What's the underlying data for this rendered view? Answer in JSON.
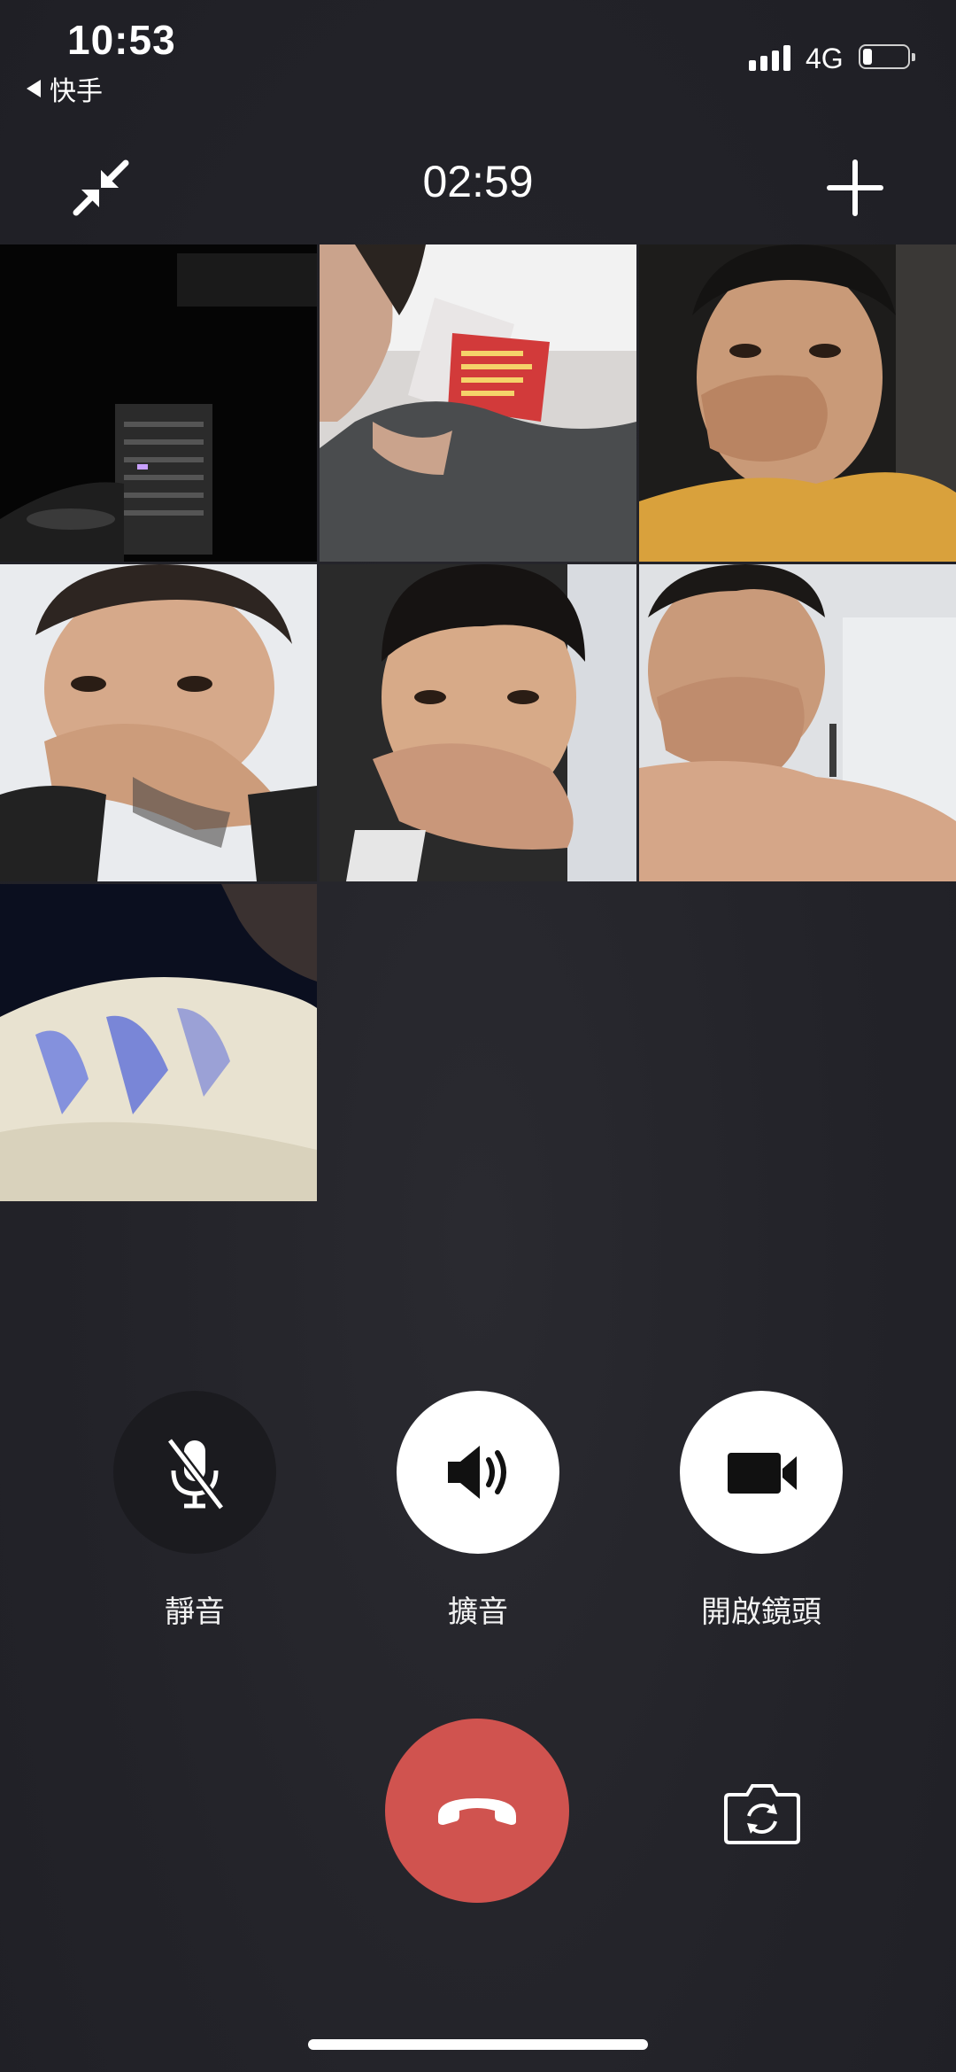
{
  "status_bar": {
    "time": "10:53",
    "back_app": "快手",
    "network": "4G",
    "battery_fraction": 0.2
  },
  "call": {
    "timer": "02:59",
    "participant_count": 7,
    "minimize_icon": "minimize-arrows-icon",
    "add_icon": "plus-icon"
  },
  "controls": {
    "mute": {
      "label": "靜音",
      "icon": "mic-off-icon",
      "active": true
    },
    "speaker": {
      "label": "擴音",
      "icon": "speaker-icon",
      "active": false
    },
    "camera": {
      "label": "開啟鏡頭",
      "icon": "video-camera-icon",
      "active": false
    },
    "end_call_icon": "hang-up-icon",
    "flip_camera_icon": "flip-camera-icon"
  },
  "colors": {
    "background": "#232329",
    "end_call": "#d0534f",
    "button_light": "#ffffff",
    "button_dark": "#1b1b1f"
  }
}
